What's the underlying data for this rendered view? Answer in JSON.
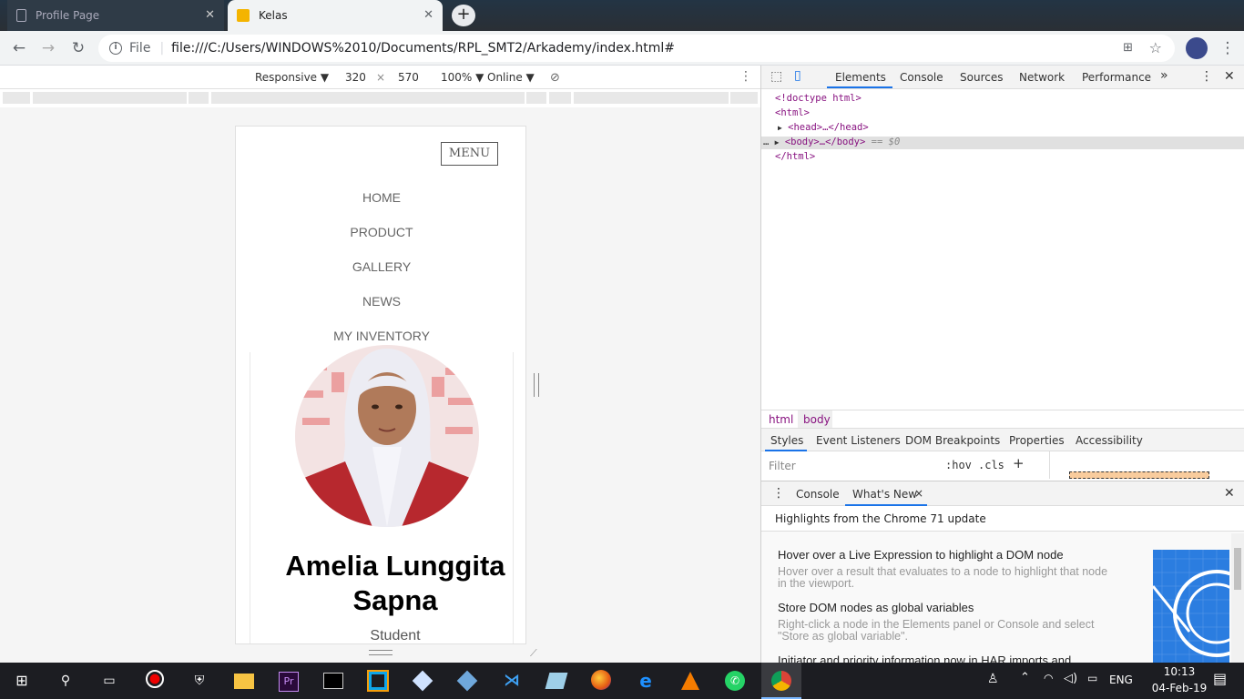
{
  "browser": {
    "tabs": [
      {
        "title": "Profile Page",
        "active": false
      },
      {
        "title": "Kelas",
        "active": true
      }
    ],
    "new_tab_label": "+",
    "url_scheme_label": "File",
    "url": "file:///C:/Users/WINDOWS%2010/Documents/RPL_SMT2/Arkademy/index.html#"
  },
  "device_toolbar": {
    "device": "Responsive ▼",
    "width": "320",
    "times": "×",
    "height": "570",
    "zoom": "100% ▼",
    "network": "Online ▼"
  },
  "page": {
    "menu_button": "MENU",
    "nav": [
      "HOME",
      "PRODUCT",
      "GALLERY",
      "NEWS",
      "MY INVENTORY"
    ],
    "name_line1": "Amelia Lunggita",
    "name_line2": "Sapna",
    "role": "Student"
  },
  "devtools": {
    "tabs": [
      "Elements",
      "Console",
      "Sources",
      "Network",
      "Performance",
      "»"
    ],
    "active_tab": "Elements",
    "dom": {
      "doctype": "<!doctype html>",
      "html_open": "<html>",
      "head": "<head>…</head>",
      "body": "<body>…</body>",
      "body_suffix": "== $0",
      "html_close": "</html>",
      "body_marker": "…"
    },
    "breadcrumbs": [
      "html",
      "body"
    ],
    "style_tabs": [
      "Styles",
      "Event Listeners",
      "DOM Breakpoints",
      "Properties",
      "Accessibility"
    ],
    "filter_placeholder": "Filter",
    "hov": ":hov",
    "cls": ".cls",
    "drawer_tabs": [
      "Console",
      "What's New"
    ],
    "drawer_close": "×",
    "highlights_title": "Highlights from the Chrome 71 update",
    "whats_new": [
      {
        "title": "Hover over a Live Expression to highlight a DOM node",
        "desc": "Hover over a result that evaluates to a node to highlight that node in the viewport."
      },
      {
        "title": "Store DOM nodes as global variables",
        "desc": "Right-click a node in the Elements panel or Console and select \"Store as global variable\"."
      },
      {
        "title": "Initiator and priority information now in HAR imports and",
        "desc": ""
      }
    ]
  },
  "taskbar": {
    "lang": "ENG",
    "time": "10:13",
    "date": "04-Feb-19"
  },
  "colors": {
    "accent": "#1a73e8",
    "dom_tag": "#881280",
    "taskbar": "#1c1d22"
  }
}
